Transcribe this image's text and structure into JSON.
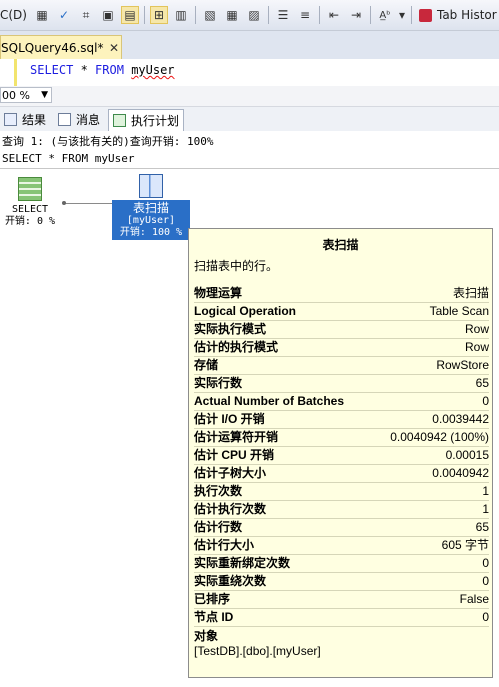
{
  "toolbar": {
    "menu_fragment": "C(D)",
    "tab_history_label": "Tab Histor"
  },
  "document_tab": {
    "name": "SQLQuery46.sql*",
    "close": "✕"
  },
  "editor": {
    "kw1": "SELECT",
    "star": " * ",
    "kw2": "FROM",
    "table": "myUser"
  },
  "zoom": {
    "value": "00 %"
  },
  "result_tabs": [
    {
      "label": "结果"
    },
    {
      "label": "消息"
    },
    {
      "label": "执行计划"
    }
  ],
  "plan": {
    "query_header": "查询 1: (与该批有关的)查询开销: 100%",
    "query_sql": "SELECT * FROM myUser",
    "select_node": {
      "label": "SELECT",
      "cost": "开销: 0 %"
    },
    "scan_node": {
      "label": "表扫描",
      "object": "[myUser]",
      "cost": "开销: 100 %"
    }
  },
  "tooltip": {
    "title": "表扫描",
    "description": "扫描表中的行。",
    "rows": [
      {
        "label": "物理运算",
        "value": "表扫描"
      },
      {
        "label": "Logical Operation",
        "value": "Table Scan"
      },
      {
        "label": "实际执行模式",
        "value": "Row"
      },
      {
        "label": "估计的执行模式",
        "value": "Row"
      },
      {
        "label": "存储",
        "value": "RowStore"
      },
      {
        "label": "实际行数",
        "value": "65"
      },
      {
        "label": "Actual Number of Batches",
        "value": "0"
      },
      {
        "label": "估计 I/O 开销",
        "value": "0.0039442"
      },
      {
        "label": "估计运算符开销",
        "value": "0.0040942 (100%)"
      },
      {
        "label": "估计 CPU 开销",
        "value": "0.00015"
      },
      {
        "label": "估计子树大小",
        "value": "0.0040942"
      },
      {
        "label": "执行次数",
        "value": "1"
      },
      {
        "label": "估计执行次数",
        "value": "1"
      },
      {
        "label": "估计行数",
        "value": "65"
      },
      {
        "label": "估计行大小",
        "value": "605 字节"
      },
      {
        "label": "实际重新绑定次数",
        "value": "0"
      },
      {
        "label": "实际重绕次数",
        "value": "0"
      },
      {
        "label": "已排序",
        "value": "False"
      },
      {
        "label": "节点 ID",
        "value": "0"
      }
    ],
    "object_title": "对象",
    "object_value": "[TestDB].[dbo].[myUser]"
  }
}
